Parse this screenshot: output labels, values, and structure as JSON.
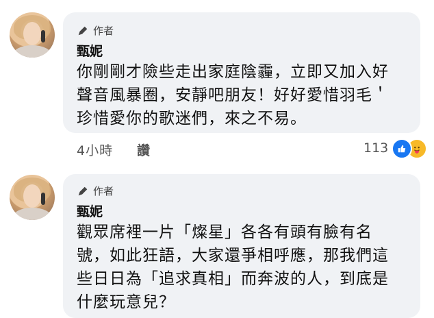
{
  "comments": [
    {
      "author_tag": "作者",
      "name": "甄妮",
      "text": "你剛剛才險些走出家庭陰霾，立即又加入好\n聲音風暴圈，安靜吧朋友！好好愛惜羽毛＇\n珍惜愛你的歌迷們，來之不易。",
      "time": "4小時",
      "reply_label": "讚",
      "reaction_count": "113",
      "reactions": [
        "like-icon",
        "care-icon"
      ]
    },
    {
      "author_tag": "作者",
      "name": "甄妮",
      "text": "觀眾席裡一片「燦星」各各有頭有臉有名\n號，如此狂語，大家還爭相呼應，那我們這\n些日日為「追求真相」而奔波的人，到底是\n什麼玩意兒？"
    }
  ],
  "colors": {
    "bubble": "#f0f2f5",
    "like": "#1877f2",
    "care": "#f7b928"
  }
}
